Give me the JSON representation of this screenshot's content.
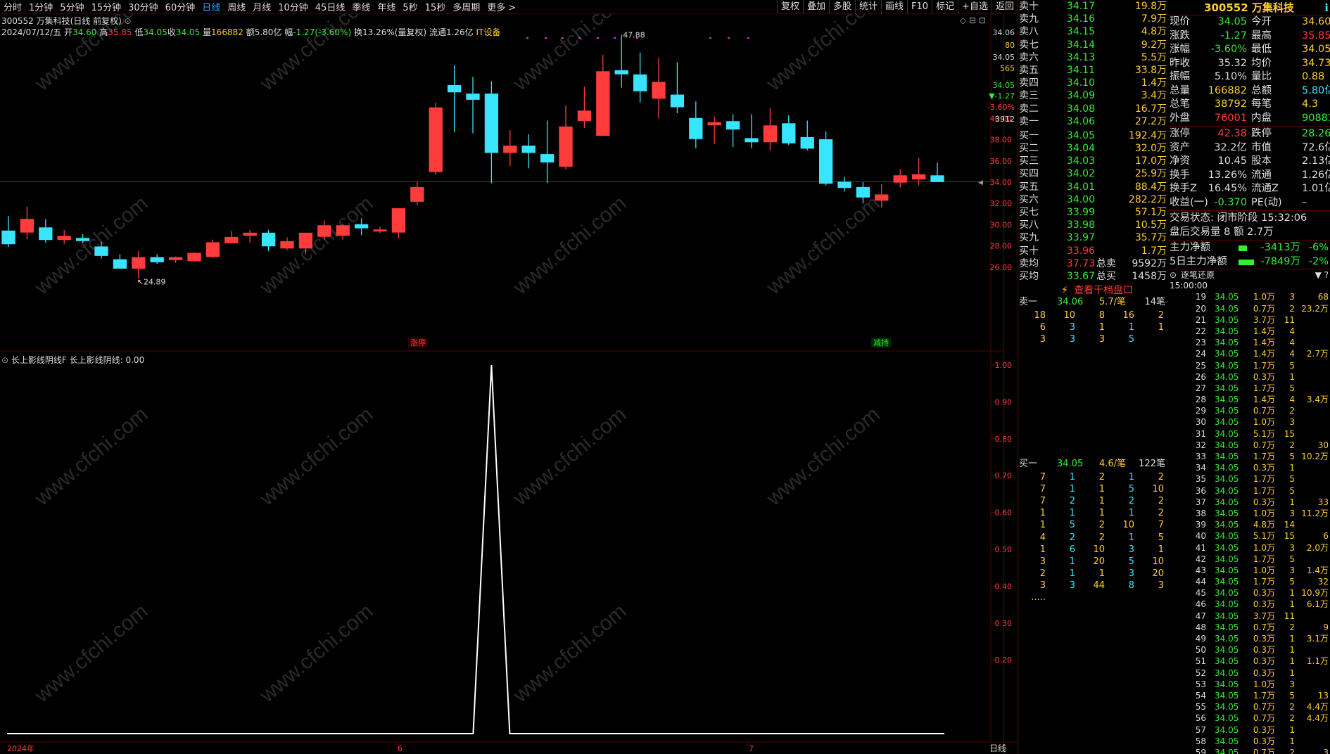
{
  "toolbar": {
    "periods": [
      "分时",
      "1分钟",
      "5分钟",
      "15分钟",
      "30分钟",
      "60分钟",
      "日线",
      "周线",
      "月线",
      "10分钟",
      "45日线",
      "季线",
      "年线",
      "5秒",
      "15秒",
      "多周期",
      "更多 >"
    ],
    "active_index": 6,
    "tools": [
      "复权",
      "叠加",
      "多股",
      "统计",
      "画线",
      "F10",
      "标记",
      "+自选",
      "返回"
    ]
  },
  "title": {
    "code": "300552",
    "name": "万集科技",
    "mode": "(日线 前复权)"
  },
  "info": {
    "date": "2024/07/12/五",
    "open_l": "开",
    "open": "34.60",
    "high_l": "高",
    "high": "35.85",
    "low_l": "低",
    "low": "34.05",
    "close_l": "收",
    "close": "34.05",
    "vol_l": "量",
    "vol": "166882",
    "amt_l": "额",
    "amt": "5.80亿",
    "chg_l": "幅",
    "chg": "-1.27(-3.60%)",
    "turn": "换13.26%(量复权)",
    "float": "流通1.26亿",
    "concept": "IT设备"
  },
  "chart_data": {
    "type": "candlestick",
    "dates": [
      "2024-05-06",
      "2024-05-07",
      "2024-05-08",
      "2024-05-09",
      "2024-05-10",
      "2024-05-13",
      "2024-05-14",
      "2024-05-15",
      "2024-05-16",
      "2024-05-17",
      "2024-05-20",
      "2024-05-21",
      "2024-05-22",
      "2024-05-23",
      "2024-05-24",
      "2024-05-27",
      "2024-05-28",
      "2024-05-29",
      "2024-05-30",
      "2024-05-31",
      "2024-06-03",
      "2024-06-04",
      "2024-06-05",
      "2024-06-06",
      "2024-06-07",
      "2024-06-11",
      "2024-06-12",
      "2024-06-13",
      "2024-06-14",
      "2024-06-17",
      "2024-06-18",
      "2024-06-19",
      "2024-06-20",
      "2024-06-21",
      "2024-06-24",
      "2024-06-25",
      "2024-06-26",
      "2024-06-27",
      "2024-06-28",
      "2024-07-01",
      "2024-07-02",
      "2024-07-03",
      "2024-07-04",
      "2024-07-05",
      "2024-07-08",
      "2024-07-09",
      "2024-07-10",
      "2024-07-11",
      "2024-07-12"
    ],
    "ohlc": [
      [
        29.4,
        30.8,
        27.9,
        28.2
      ],
      [
        29.3,
        31.7,
        28.6,
        30.5
      ],
      [
        29.7,
        30.5,
        28.3,
        28.6
      ],
      [
        28.6,
        29.5,
        28.2,
        28.9
      ],
      [
        28.7,
        29.1,
        28.3,
        28.5
      ],
      [
        27.9,
        28.4,
        26.8,
        27.1
      ],
      [
        26.7,
        27.2,
        25.9,
        25.9
      ],
      [
        25.9,
        27.5,
        24.89,
        26.9
      ],
      [
        26.9,
        27.2,
        26.3,
        26.5
      ],
      [
        26.7,
        27.0,
        26.4,
        26.9
      ],
      [
        26.6,
        27.4,
        26.5,
        27.3
      ],
      [
        27.0,
        28.6,
        26.9,
        28.3
      ],
      [
        28.3,
        29.4,
        28.3,
        28.8
      ],
      [
        29.0,
        29.5,
        28.3,
        29.2
      ],
      [
        29.2,
        29.5,
        27.5,
        28.0
      ],
      [
        27.8,
        28.8,
        27.6,
        28.4
      ],
      [
        27.8,
        29.2,
        27.2,
        29.2
      ],
      [
        28.9,
        30.4,
        28.6,
        29.9
      ],
      [
        29.0,
        30.1,
        28.6,
        29.9
      ],
      [
        30.0,
        30.6,
        29.0,
        29.7
      ],
      [
        29.5,
        29.8,
        29.2,
        29.5
      ],
      [
        29.3,
        31.5,
        28.7,
        31.5
      ],
      [
        32.2,
        34.0,
        31.8,
        33.5
      ],
      [
        35.0,
        41.5,
        34.7,
        41.0
      ],
      [
        43.1,
        45.0,
        38.7,
        42.5
      ],
      [
        42.3,
        43.9,
        38.6,
        41.8
      ],
      [
        42.3,
        43.5,
        33.9,
        36.8
      ],
      [
        36.8,
        38.9,
        35.5,
        37.4
      ],
      [
        37.4,
        38.5,
        35.3,
        36.8
      ],
      [
        36.6,
        39.8,
        33.9,
        35.9
      ],
      [
        35.5,
        41.2,
        35.2,
        39.2
      ],
      [
        39.8,
        43.0,
        39.1,
        40.7
      ],
      [
        38.4,
        46.0,
        38.4,
        44.4
      ],
      [
        44.5,
        47.88,
        42.9,
        44.2
      ],
      [
        44.1,
        46.2,
        41.5,
        42.6
      ],
      [
        41.9,
        45.7,
        40.0,
        43.4
      ],
      [
        42.2,
        45.3,
        40.5,
        41.1
      ],
      [
        40.0,
        41.6,
        37.2,
        38.1
      ],
      [
        39.4,
        40.2,
        37.6,
        39.6
      ],
      [
        39.7,
        40.4,
        37.3,
        39.0
      ],
      [
        38.1,
        40.4,
        37.2,
        37.8
      ],
      [
        37.8,
        41.0,
        37.0,
        39.3
      ],
      [
        39.5,
        40.3,
        37.5,
        37.7
      ],
      [
        38.2,
        39.8,
        37.0,
        37.2
      ],
      [
        38.0,
        38.8,
        33.7,
        33.9
      ],
      [
        34.0,
        34.5,
        33.1,
        33.5
      ],
      [
        33.5,
        34.0,
        32.0,
        32.6
      ],
      [
        32.3,
        33.8,
        31.6,
        32.8
      ],
      [
        34.0,
        35.2,
        33.5,
        34.6
      ],
      [
        34.3,
        36.3,
        33.7,
        34.7
      ],
      [
        34.6,
        35.85,
        34.05,
        34.05
      ]
    ],
    "price_ticks": [
      "40.00",
      "38.00",
      "36.00",
      "34.00",
      "32.00",
      "30.00",
      "28.00",
      "26.00"
    ],
    "high_label": "47.88",
    "low_label": "24.89",
    "right_labels": [
      "34.06",
      "80",
      "34.05",
      "565",
      "34.05",
      "▼-1.27",
      "-3.60%",
      "3912"
    ],
    "markers": [
      {
        "text": "涨停",
        "color": "#ff3c3c"
      },
      {
        "text": "减持",
        "color": "#33ee33"
      }
    ],
    "indicator": {
      "name": "长上影线阴线F",
      "line": "长上影线阴线: 0.00",
      "ticks": [
        "1.00",
        "0.90",
        "0.80",
        "0.70",
        "0.60",
        "0.50",
        "0.40",
        "0.30",
        "0.20"
      ],
      "values": [
        0,
        0,
        0,
        0,
        0,
        0,
        0,
        0,
        0,
        0,
        0,
        0,
        0,
        0,
        0,
        0,
        0,
        0,
        0,
        0,
        0,
        0,
        0,
        0,
        0,
        0,
        1,
        0,
        0,
        0,
        0,
        0,
        0,
        0,
        0,
        0,
        0,
        0,
        0,
        0,
        0,
        0,
        0,
        0,
        0,
        0,
        0,
        0,
        0
      ]
    },
    "x_labels": [
      "2024年",
      "6",
      "7"
    ],
    "period_label": "日线"
  },
  "orderbook": {
    "sells": [
      [
        "卖十",
        "34.17",
        "19.8万"
      ],
      [
        "卖九",
        "34.16",
        "7.9万"
      ],
      [
        "卖八",
        "34.15",
        "4.8万"
      ],
      [
        "卖七",
        "34.14",
        "9.2万"
      ],
      [
        "卖六",
        "34.13",
        "5.5万"
      ],
      [
        "卖五",
        "34.11",
        "33.8万"
      ],
      [
        "卖四",
        "34.10",
        "1.4万"
      ],
      [
        "卖三",
        "34.09",
        "3.4万"
      ],
      [
        "卖二",
        "34.08",
        "16.7万"
      ],
      [
        "卖一",
        "34.06",
        "27.2万"
      ]
    ],
    "buys": [
      [
        "买一",
        "34.05",
        "192.4万"
      ],
      [
        "买二",
        "34.04",
        "32.0万"
      ],
      [
        "买三",
        "34.03",
        "17.0万"
      ],
      [
        "买四",
        "34.02",
        "25.9万"
      ],
      [
        "买五",
        "34.01",
        "88.4万"
      ],
      [
        "买六",
        "34.00",
        "282.2万"
      ],
      [
        "买七",
        "33.99",
        "57.1万"
      ],
      [
        "买八",
        "33.98",
        "10.5万"
      ],
      [
        "买九",
        "33.97",
        "35.7万"
      ],
      [
        "买十",
        "33.96",
        "1.7万"
      ]
    ],
    "sell_avg": [
      "卖均",
      "37.73",
      "总卖",
      "9592万"
    ],
    "buy_avg": [
      "买均",
      "33.67",
      "总买",
      "1458万"
    ],
    "thousand": "查看千档盘口"
  },
  "queue": {
    "sell_head": [
      "卖一",
      "34.06",
      "5.7/笔",
      "14笔"
    ],
    "sell_rows": [
      [
        "18",
        "10",
        "8",
        "16",
        "2"
      ],
      [
        "6",
        "3",
        "1",
        "1",
        "1"
      ],
      [
        "3",
        "3",
        "3",
        "5",
        ""
      ]
    ],
    "buy_head": [
      "买一",
      "34.05",
      "4.6/笔",
      "122笔"
    ],
    "buy_rows": [
      [
        "7",
        "1",
        "2",
        "1",
        "2"
      ],
      [
        "7",
        "1",
        "1",
        "5",
        "10"
      ],
      [
        "7",
        "2",
        "1",
        "2",
        "2"
      ],
      [
        "1",
        "1",
        "1",
        "1",
        "2"
      ],
      [
        "1",
        "5",
        "2",
        "10",
        "7"
      ],
      [
        "4",
        "2",
        "2",
        "1",
        "5"
      ],
      [
        "1",
        "6",
        "10",
        "3",
        "1"
      ],
      [
        "3",
        "1",
        "20",
        "5",
        "10"
      ],
      [
        "2",
        "1",
        "1",
        "3",
        "20"
      ],
      [
        "3",
        "3",
        "44",
        "8",
        "3"
      ]
    ],
    "more": "....."
  },
  "quote": {
    "code": "300552",
    "name": "万集科技",
    "rows": [
      [
        "现价",
        "34.05",
        "今开",
        "34.60"
      ],
      [
        "涨跌",
        "-1.27",
        "最高",
        "35.85"
      ],
      [
        "涨幅",
        "-3.60%",
        "最低",
        "34.05"
      ],
      [
        "昨收",
        "35.32",
        "均价",
        "34.73"
      ],
      [
        "振幅",
        "5.10%",
        "量比",
        "0.88"
      ],
      [
        "总量",
        "166882",
        "总额",
        "5.80亿"
      ],
      [
        "总笔",
        "38792",
        "每笔",
        "4.3"
      ],
      [
        "外盘",
        "76001",
        "内盘",
        "90881"
      ]
    ],
    "rows2": [
      [
        "涨停",
        "42.38",
        "跌停",
        "28.26"
      ],
      [
        "资产",
        "32.2亿",
        "市值",
        "72.6亿"
      ],
      [
        "净资",
        "10.45",
        "股本",
        "2.13亿"
      ],
      [
        "换手",
        "13.26%",
        "流通",
        "1.26亿"
      ],
      [
        "换手Z",
        "16.45%",
        "流通Z",
        "1.01亿"
      ],
      [
        "收益(一)",
        "-0.370",
        "PE(动)",
        "–"
      ]
    ],
    "status": "交易状态: 闭市阶段 15:32:06",
    "after": "盘后交易量 8 额 2.7万",
    "main_flow": [
      "主力净额",
      "-3413万",
      "-6%"
    ],
    "flow5": [
      "5日主力净额",
      "-7849万",
      "-2%"
    ]
  },
  "ticks": {
    "title": "逐笔还原",
    "first_time": "15:00:00",
    "rows": [
      [
        "19",
        "34.05",
        "1.0万",
        "3"
      ],
      [
        "20",
        "34.05",
        "0.7万",
        "2"
      ],
      [
        "21",
        "34.05",
        "3.7万",
        "11"
      ],
      [
        "22",
        "34.05",
        "1.4万",
        "4"
      ],
      [
        "23",
        "34.05",
        "1.4万",
        "4"
      ],
      [
        "24",
        "34.05",
        "1.4万",
        "4"
      ],
      [
        "25",
        "34.05",
        "1.7万",
        "5"
      ],
      [
        "26",
        "34.05",
        "0.3万",
        "1"
      ],
      [
        "27",
        "34.05",
        "1.7万",
        "5"
      ],
      [
        "28",
        "34.05",
        "1.4万",
        "4"
      ],
      [
        "29",
        "34.05",
        "0.7万",
        "2"
      ],
      [
        "30",
        "34.05",
        "1.0万",
        "3"
      ],
      [
        "31",
        "34.05",
        "5.1万",
        "15"
      ],
      [
        "32",
        "34.05",
        "0.7万",
        "2"
      ],
      [
        "33",
        "34.05",
        "1.7万",
        "5"
      ],
      [
        "34",
        "34.05",
        "0.3万",
        "1"
      ],
      [
        "35",
        "34.05",
        "1.7万",
        "5"
      ],
      [
        "36",
        "34.05",
        "1.7万",
        "5"
      ],
      [
        "37",
        "34.05",
        "0.3万",
        "1"
      ],
      [
        "38",
        "34.05",
        "1.0万",
        "3"
      ],
      [
        "39",
        "34.05",
        "4.8万",
        "14"
      ],
      [
        "40",
        "34.05",
        "5.1万",
        "15"
      ],
      [
        "41",
        "34.05",
        "1.0万",
        "3"
      ],
      [
        "42",
        "34.05",
        "1.7万",
        "5"
      ],
      [
        "43",
        "34.05",
        "1.0万",
        "3"
      ],
      [
        "44",
        "34.05",
        "1.7万",
        "5"
      ],
      [
        "45",
        "34.05",
        "0.3万",
        "1"
      ],
      [
        "46",
        "34.05",
        "0.3万",
        "1"
      ],
      [
        "47",
        "34.05",
        "3.7万",
        "11"
      ],
      [
        "48",
        "34.05",
        "0.7万",
        "2"
      ],
      [
        "49",
        "34.05",
        "0.3万",
        "1"
      ],
      [
        "50",
        "34.05",
        "0.3万",
        "1"
      ],
      [
        "51",
        "34.05",
        "0.3万",
        "1"
      ],
      [
        "52",
        "34.05",
        "0.3万",
        "1"
      ],
      [
        "53",
        "34.05",
        "1.0万",
        "3"
      ],
      [
        "54",
        "34.05",
        "1.7万",
        "5"
      ],
      [
        "55",
        "34.05",
        "0.7万",
        "2"
      ],
      [
        "56",
        "34.05",
        "0.7万",
        "2"
      ],
      [
        "57",
        "34.05",
        "0.3万",
        "1"
      ],
      [
        "58",
        "34.05",
        "0.3万",
        "1"
      ],
      [
        "59",
        "34.05",
        "0.7万",
        "2"
      ]
    ],
    "side": [
      {
        "row": 1,
        "a": "68",
        "b": "23.2万"
      },
      {
        "row": 6,
        "a": "2.7万"
      },
      {
        "row": 9,
        "a": "",
        "b": "3.4万"
      },
      {
        "row": 14,
        "a": "30",
        "b": "10.2万"
      },
      {
        "row": 19,
        "a": "33",
        "b": "11.2万"
      },
      {
        "row": 22,
        "a": "6",
        "b": "2.0万"
      },
      {
        "row": 25,
        "a": "1.4万"
      },
      {
        "row": 26,
        "a": "32",
        "b": "10.9万"
      },
      {
        "row": 28,
        "a": "6.1万"
      },
      {
        "row": 30,
        "a": "9",
        "b": "3.1万"
      },
      {
        "row": 33,
        "a": "1.1万"
      },
      {
        "row": 36,
        "a": "13",
        "b": "4.4万"
      },
      {
        "row": 38,
        "a": "4.4万"
      },
      {
        "row": 41,
        "a": "3",
        "b": "1.0万"
      },
      {
        "row": 43,
        "a": "0.7万"
      },
      {
        "row": 47,
        "a": "6",
        "b": "2.0万"
      },
      {
        "row": 50,
        "a": "0.7万"
      },
      {
        "row": 52,
        "a": "3.1万"
      },
      {
        "row": 55,
        "a": "2",
        "b": "0.7万"
      }
    ]
  },
  "watermark": "www.cfchi.com"
}
